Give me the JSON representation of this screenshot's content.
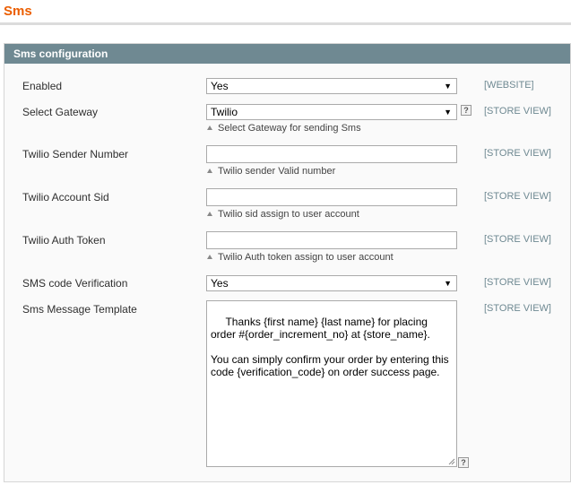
{
  "page": {
    "title": "Sms"
  },
  "section": {
    "title": "Sms configuration"
  },
  "fields": {
    "enabled": {
      "label": "Enabled",
      "value": "Yes",
      "scope": "[WEBSITE]"
    },
    "gateway": {
      "label": "Select Gateway",
      "value": "Twilio",
      "note": "Select Gateway for sending Sms",
      "scope": "[STORE VIEW]"
    },
    "sender_number": {
      "label": "Twilio Sender Number",
      "value": "",
      "note": "Twilio sender Valid number",
      "scope": "[STORE VIEW]"
    },
    "account_sid": {
      "label": "Twilio Account Sid",
      "value": "",
      "note": "Twilio sid assign to user account",
      "scope": "[STORE VIEW]"
    },
    "auth_token": {
      "label": "Twilio Auth Token",
      "value": "",
      "note": "Twilio Auth token assign to user account",
      "scope": "[STORE VIEW]"
    },
    "code_verification": {
      "label": "SMS code Verification",
      "value": "Yes",
      "scope": "[STORE VIEW]"
    },
    "message_template": {
      "label": "Sms Message Template",
      "value": " Thanks {first name} {last name} for placing order #{order_increment_no} at {store_name}.\n\nYou can simply confirm your order by entering this code {verification_code} on order success page.",
      "scope": "[STORE VIEW]"
    }
  },
  "help_glyph": "?",
  "icons": {
    "dropdown": "chevron-down-icon",
    "note": "triangle-up-icon",
    "help": "help-icon"
  }
}
